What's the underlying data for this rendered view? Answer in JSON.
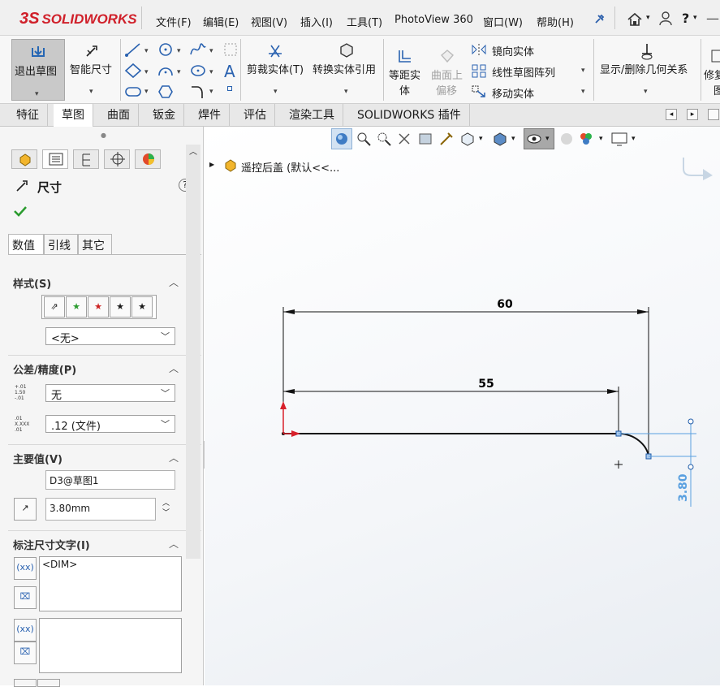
{
  "app": {
    "logo_prefix": "3S",
    "logo_text": "SOLIDWORKS"
  },
  "menus": [
    "文件(F)",
    "编辑(E)",
    "视图(V)",
    "插入(I)",
    "工具(T)",
    "PhotoView 360",
    "窗口(W)",
    "帮助(H)"
  ],
  "ribbon": {
    "exit_sketch": "退出草图",
    "smart_dimension": "智能尺寸",
    "trim_entities": "剪裁实体(T)",
    "convert_entities": "转换实体引用",
    "offset_entities_1": "等距实",
    "offset_entities_2": "体",
    "offset_surface_1": "曲面上",
    "offset_surface_2": "偏移",
    "mirror_entities": "镜向实体",
    "linear_pattern": "线性草图阵列",
    "move_entities": "移动实体",
    "display_relations": "显示/删除几何关系",
    "repair_1": "修复",
    "repair_2": "图"
  },
  "tabs": [
    "特征",
    "草图",
    "曲面",
    "钣金",
    "焊件",
    "评估",
    "渲染工具",
    "SOLIDWORKS 插件"
  ],
  "active_tab": "草图",
  "panel": {
    "title": "尺寸",
    "subtabs": [
      "数值",
      "引线",
      "其它"
    ],
    "style_section": "样式(S)",
    "style_select": "<无>",
    "tolerance_section": "公差/精度(P)",
    "tolerance_type": "无",
    "precision": ".12 (文件)",
    "primary_section": "主要值(V)",
    "dim_name": "D3@草图1",
    "dim_value": "3.80mm",
    "dim_text_section": "标注尺寸文字(I)",
    "dim_text_value": "<DIM>",
    "tol_icon_top": "+.01",
    "tol_icon_mid": "1.50",
    "tol_icon_bot": "-.01",
    "prec_icon_top": ".01",
    "prec_icon_mid": "X.XXX",
    "prec_icon_bot": ".01"
  },
  "tree": {
    "item": "遥控后盖  (默认<<..."
  },
  "drawing": {
    "dim_60": "60",
    "dim_55": "55",
    "dim_380": "3.80"
  }
}
